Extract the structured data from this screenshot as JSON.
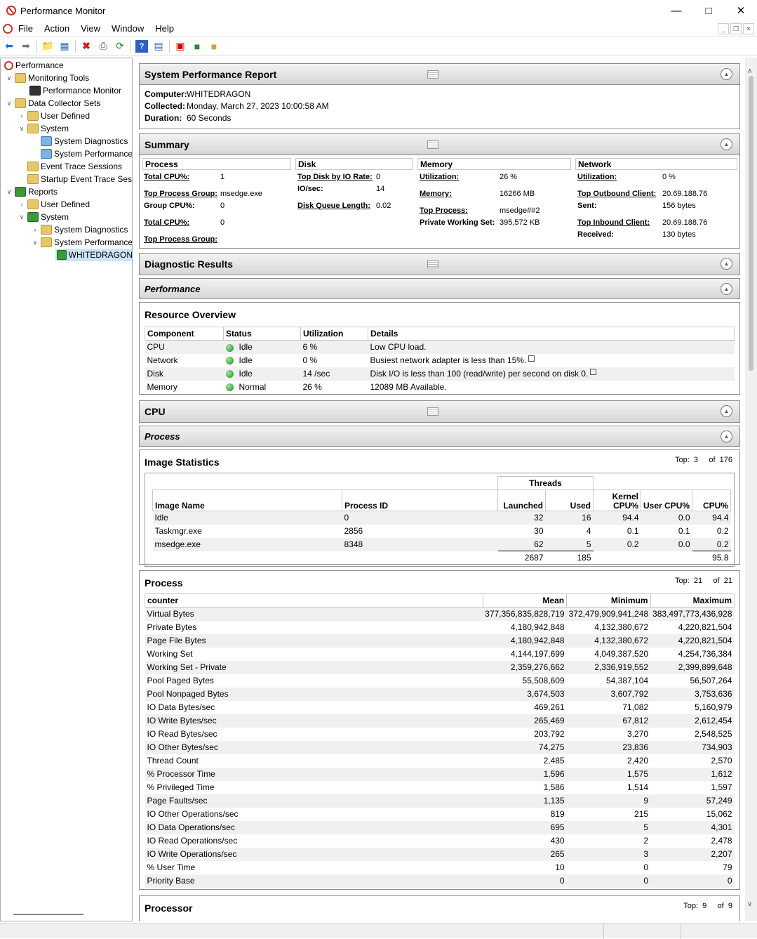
{
  "window": {
    "title": "Performance Monitor"
  },
  "menu": {
    "items": [
      "File",
      "Action",
      "View",
      "Window",
      "Help"
    ]
  },
  "tree": {
    "root": "Performance",
    "monitoring_tools": "Monitoring Tools",
    "performance_monitor": "Performance Monitor",
    "data_collector_sets": "Data Collector Sets",
    "dcs_user_defined": "User Defined",
    "dcs_system": "System",
    "dcs_system_diagnostics": "System Diagnostics",
    "dcs_system_performance": "System Performance",
    "event_trace_sessions": "Event Trace Sessions",
    "startup_event_trace": "Startup Event Trace Sessions",
    "reports": "Reports",
    "rep_user_defined": "User Defined",
    "rep_system": "System",
    "rep_system_diagnostics": "System Diagnostics",
    "rep_system_performance": "System Performance",
    "whitedragon": "WHITEDRAGON"
  },
  "report": {
    "title": "System Performance Report",
    "computer_label": "Computer:",
    "computer": "WHITEDRAGON",
    "collected_label": "Collected:",
    "collected": "Monday, March 27, 2023 10:00:58 AM",
    "duration_label": "Duration:",
    "duration": "60 Seconds"
  },
  "summary": {
    "title": "Summary",
    "process_h": "Process",
    "disk_h": "Disk",
    "memory_h": "Memory",
    "network_h": "Network",
    "p_total_cpu_l": "Total CPU%:",
    "p_total_cpu_v": "1",
    "p_top_group_l": "Top Process Group:",
    "p_top_group_v": "msedge.exe",
    "p_group_cpu_l": "Group CPU%:",
    "p_group_cpu_v": "0",
    "p_total_cpu2_l": "Total CPU%:",
    "p_total_cpu2_v": "0",
    "p_top_group2_l": "Top Process Group:",
    "d_top_disk_l": "Top Disk by IO Rate:",
    "d_top_disk_v": "0",
    "d_io_l": "IO/sec:",
    "d_io_v": "14",
    "d_queue_l": "Disk Queue Length:",
    "d_queue_v": "0.02",
    "m_util_l": "Utilization:",
    "m_util_v": "26 %",
    "m_mem_l": "Memory:",
    "m_mem_v": "16266 MB",
    "m_top_l": "Top Process:",
    "m_top_v": "msedge##2",
    "m_pws_l": "Private Working Set:",
    "m_pws_v": "395,572 KB",
    "n_util_l": "Utilization:",
    "n_util_v": "0 %",
    "n_out_l": "Top Outbound Client:",
    "n_out_v": "20.69.188.76",
    "n_sent_l": "Sent:",
    "n_sent_v": "156 bytes",
    "n_in_l": "Top Inbound Client:",
    "n_in_v": "20.69.188.76",
    "n_recv_l": "Received:",
    "n_recv_v": "130 bytes"
  },
  "diag": {
    "title": "Diagnostic Results",
    "performance": "Performance"
  },
  "resource": {
    "title": "Resource Overview",
    "headers": [
      "Component",
      "Status",
      "Utilization",
      "Details"
    ],
    "rows": [
      {
        "component": "CPU",
        "status": "Idle",
        "util": "6 %",
        "details": "Low CPU load."
      },
      {
        "component": "Network",
        "status": "Idle",
        "util": "0 %",
        "details": "Busiest network adapter is less than 15%."
      },
      {
        "component": "Disk",
        "status": "Idle",
        "util": "14 /sec",
        "details": "Disk I/O is less than 100 (read/write) per second on disk 0."
      },
      {
        "component": "Memory",
        "status": "Normal",
        "util": "26 %",
        "details": "12089 MB Available."
      }
    ]
  },
  "cpu": {
    "title": "CPU",
    "process": "Process"
  },
  "image_stats": {
    "title": "Image Statistics",
    "top_label": "Top:",
    "top": "3",
    "of_label": "of",
    "of": "176",
    "threads_h": "Threads",
    "headers": [
      "Image Name",
      "Process ID",
      "Launched",
      "Used",
      "Kernel CPU%",
      "User CPU%",
      "CPU%"
    ],
    "rows": [
      [
        "Idle",
        "0",
        "32",
        "16",
        "94.4",
        "0.0",
        "94.4"
      ],
      [
        "Taskmgr.exe",
        "2856",
        "30",
        "4",
        "0.1",
        "0.1",
        "0.2"
      ],
      [
        "msedge.exe",
        "8348",
        "62",
        "5",
        "0.2",
        "0.0",
        "0.2"
      ]
    ],
    "totals": {
      "launched": "2687",
      "used": "185",
      "cpu": "95.8"
    }
  },
  "process_table": {
    "title": "Process",
    "top_label": "Top:",
    "top": "21",
    "of_label": "of",
    "of": "21",
    "headers": [
      "counter",
      "Mean",
      "Minimum",
      "Maximum"
    ],
    "rows": [
      [
        "Virtual Bytes",
        "377,356,835,828,719",
        "372,479,909,941,248",
        "383,497,773,436,928"
      ],
      [
        "Private Bytes",
        "4,180,942,848",
        "4,132,380,672",
        "4,220,821,504"
      ],
      [
        "Page File Bytes",
        "4,180,942,848",
        "4,132,380,672",
        "4,220,821,504"
      ],
      [
        "Working Set",
        "4,144,197,699",
        "4,049,387,520",
        "4,254,736,384"
      ],
      [
        "Working Set - Private",
        "2,359,276,662",
        "2,336,919,552",
        "2,399,899,648"
      ],
      [
        "Pool Paged Bytes",
        "55,508,609",
        "54,387,104",
        "56,507,264"
      ],
      [
        "Pool Nonpaged Bytes",
        "3,674,503",
        "3,607,792",
        "3,753,636"
      ],
      [
        "IO Data Bytes/sec",
        "469,261",
        "71,082",
        "5,160,979"
      ],
      [
        "IO Write Bytes/sec",
        "265,469",
        "67,812",
        "2,612,454"
      ],
      [
        "IO Read Bytes/sec",
        "203,792",
        "3,270",
        "2,548,525"
      ],
      [
        "IO Other Bytes/sec",
        "74,275",
        "23,836",
        "734,903"
      ],
      [
        "Thread Count",
        "2,485",
        "2,420",
        "2,570"
      ],
      [
        "% Processor Time",
        "1,596",
        "1,575",
        "1,612"
      ],
      [
        "% Privileged Time",
        "1,586",
        "1,514",
        "1,597"
      ],
      [
        "Page Faults/sec",
        "1,135",
        "9",
        "57,249"
      ],
      [
        "IO Other Operations/sec",
        "819",
        "215",
        "15,062"
      ],
      [
        "IO Data Operations/sec",
        "695",
        "5",
        "4,301"
      ],
      [
        "IO Read Operations/sec",
        "430",
        "2",
        "2,478"
      ],
      [
        "IO Write Operations/sec",
        "265",
        "3",
        "2,207"
      ],
      [
        "% User Time",
        "10",
        "0",
        "79"
      ],
      [
        "Priority Base",
        "0",
        "0",
        "0"
      ]
    ]
  },
  "processor": {
    "title": "Processor",
    "top_label": "Top:",
    "top": "9",
    "of_label": "of",
    "of": "9"
  }
}
